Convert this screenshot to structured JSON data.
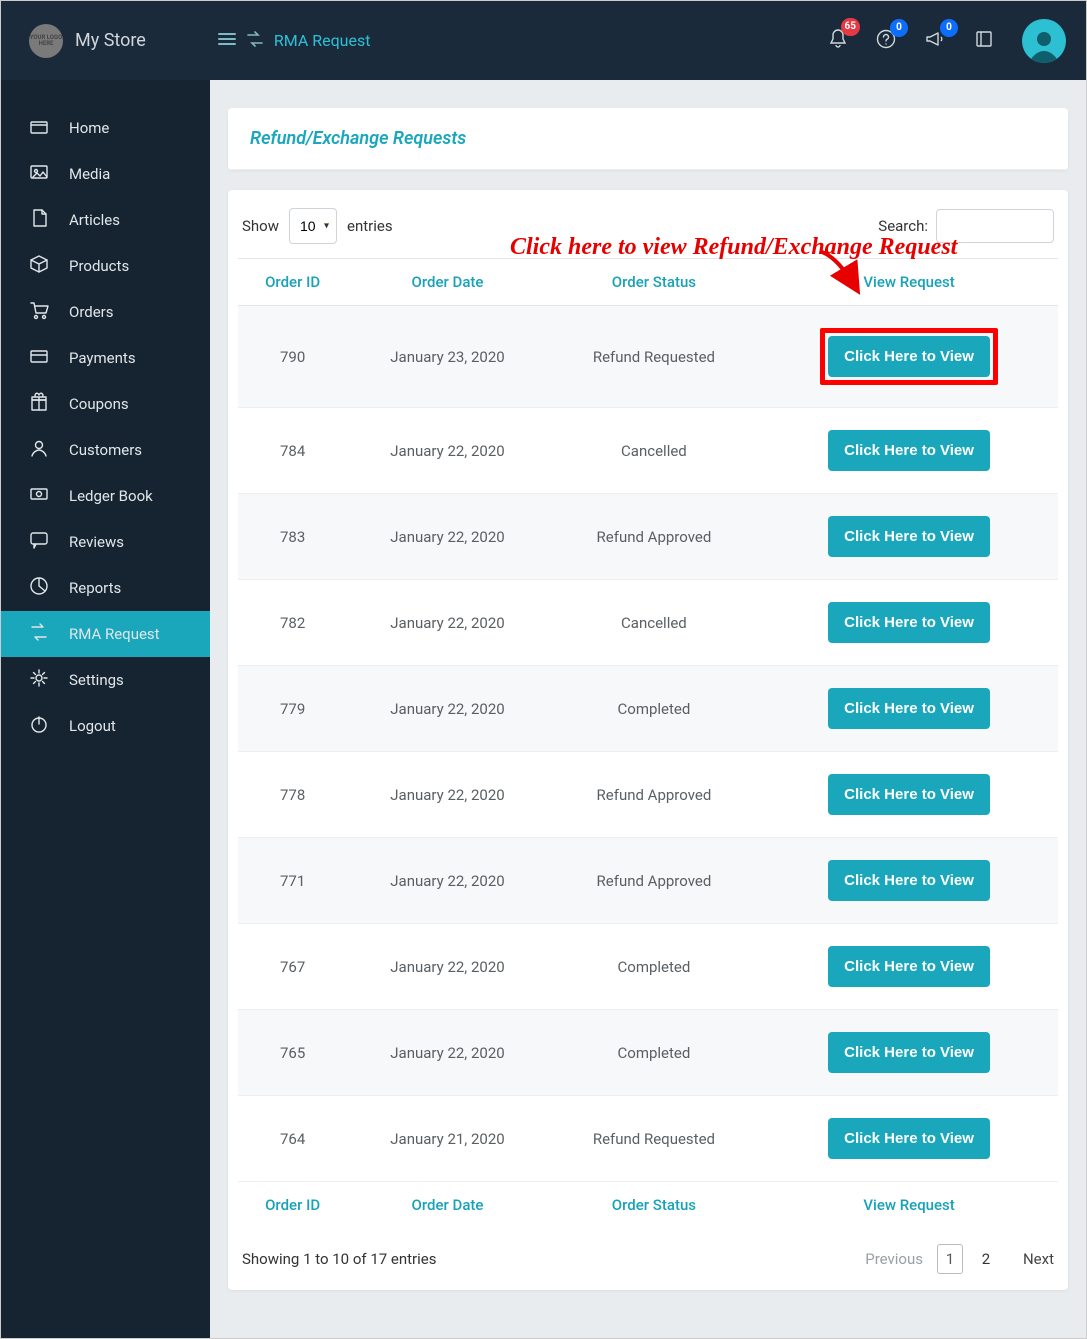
{
  "header": {
    "store_name": "My Store",
    "logo_text": "YOUR LOGO HERE",
    "breadcrumb": "RMA Request",
    "badges": {
      "bell": "65",
      "help": "0",
      "announce": "0"
    }
  },
  "sidebar": {
    "items": [
      {
        "label": "Home",
        "icon": "home"
      },
      {
        "label": "Media",
        "icon": "media"
      },
      {
        "label": "Articles",
        "icon": "file"
      },
      {
        "label": "Products",
        "icon": "box"
      },
      {
        "label": "Orders",
        "icon": "cart"
      },
      {
        "label": "Payments",
        "icon": "card"
      },
      {
        "label": "Coupons",
        "icon": "gift"
      },
      {
        "label": "Customers",
        "icon": "user"
      },
      {
        "label": "Ledger Book",
        "icon": "money"
      },
      {
        "label": "Reviews",
        "icon": "chat"
      },
      {
        "label": "Reports",
        "icon": "pie"
      },
      {
        "label": "RMA Request",
        "icon": "refresh",
        "active": true
      },
      {
        "label": "Settings",
        "icon": "gear"
      },
      {
        "label": "Logout",
        "icon": "power"
      }
    ]
  },
  "page": {
    "title": "Refund/Exchange Requests",
    "annotation_text": "Click here to view Refund/Exchange Request",
    "show_label_pre": "Show",
    "show_label_post": "entries",
    "show_value": "10",
    "search_label": "Search:",
    "columns": [
      "Order ID",
      "Order Date",
      "Order Status",
      "View Request"
    ],
    "view_button_label": "Click Here to View",
    "rows": [
      {
        "id": "790",
        "date": "January 23, 2020",
        "status": "Refund Requested",
        "highlight": true
      },
      {
        "id": "784",
        "date": "January 22, 2020",
        "status": "Cancelled"
      },
      {
        "id": "783",
        "date": "January 22, 2020",
        "status": "Refund Approved"
      },
      {
        "id": "782",
        "date": "January 22, 2020",
        "status": "Cancelled"
      },
      {
        "id": "779",
        "date": "January 22, 2020",
        "status": "Completed"
      },
      {
        "id": "778",
        "date": "January 22, 2020",
        "status": "Refund Approved"
      },
      {
        "id": "771",
        "date": "January 22, 2020",
        "status": "Refund Approved"
      },
      {
        "id": "767",
        "date": "January 22, 2020",
        "status": "Completed"
      },
      {
        "id": "765",
        "date": "January 22, 2020",
        "status": "Completed"
      },
      {
        "id": "764",
        "date": "January 21, 2020",
        "status": "Refund Requested"
      }
    ],
    "info_text": "Showing 1 to 10 of 17 entries",
    "pager": {
      "prev": "Previous",
      "pages": [
        "1",
        "2"
      ],
      "current": "1",
      "next": "Next"
    }
  }
}
